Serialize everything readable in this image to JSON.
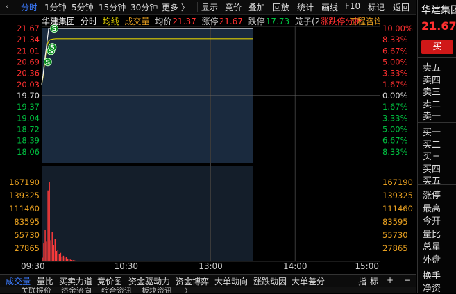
{
  "top_tabs": [
    {
      "label": "分时",
      "active": true
    },
    {
      "label": "1分钟",
      "active": false
    },
    {
      "label": "5分钟",
      "active": false
    },
    {
      "label": "15分钟",
      "active": false
    },
    {
      "label": "30分钟",
      "active": false
    },
    {
      "label": "更多 〉",
      "active": false
    }
  ],
  "top_tools": [
    "显示",
    "竞价",
    "叠加",
    "回放",
    "统计",
    "画线",
    "F10",
    "标记",
    "返回"
  ],
  "info": {
    "name": "华建集团",
    "period": "分时",
    "avg_label": "均线",
    "vol_label": "成交量",
    "avg_price_label": "均价",
    "avg_price": "21.37",
    "limit_up_label": "涨停",
    "limit_up": "21.67",
    "limit_down_label": "跌停",
    "limit_down": "17.73",
    "cage_label": "笼子(2",
    "cage_tail": "涨跌停分析",
    "overlay_text": "工程咨询"
  },
  "chart_data": {
    "type": "line",
    "price_ticks": [
      "21.67",
      "21.34",
      "21.01",
      "20.69",
      "20.36",
      "20.03",
      "19.70",
      "19.37",
      "19.04",
      "18.72",
      "18.39",
      "18.06"
    ],
    "pct_ticks": [
      "10.00%",
      "8.33%",
      "6.67%",
      "5.00%",
      "3.33%",
      "1.67%",
      "0.00%",
      "1.67%",
      "3.33%",
      "5.00%",
      "6.67%",
      "8.33%"
    ],
    "vol_ticks": [
      "167190",
      "139325",
      "111460",
      "83595",
      "55730",
      "27865"
    ],
    "time_ticks": [
      "09:30",
      "10:30",
      "13:00",
      "14:00",
      "15:00"
    ],
    "prev_close": 19.7,
    "ylim": [
      17.73,
      21.67
    ],
    "vol_max": 195055,
    "price": {
      "t": [
        0,
        1,
        2,
        3,
        4,
        5,
        6,
        8,
        10,
        15,
        30,
        60,
        90,
        120,
        150
      ],
      "v": [
        20.03,
        20.3,
        20.69,
        21.01,
        21.34,
        21.67,
        21.67,
        21.67,
        21.67,
        21.67,
        21.67,
        21.67,
        21.67,
        21.67,
        21.67
      ]
    },
    "average": {
      "t": [
        0,
        1,
        2,
        3,
        4,
        5,
        6,
        8,
        10,
        15,
        30,
        60,
        90,
        120,
        150
      ],
      "v": [
        20.03,
        20.25,
        20.62,
        20.95,
        21.2,
        21.3,
        21.34,
        21.36,
        21.37,
        21.37,
        21.37,
        21.37,
        21.37,
        21.37,
        21.37
      ]
    },
    "volume": [
      8000,
      38000,
      66000,
      42000,
      150000,
      168000,
      45000,
      62000,
      35000,
      48000,
      22000,
      25000,
      15000,
      18000,
      10000,
      12000,
      8000,
      9000,
      6000,
      5000,
      4000,
      3000,
      2500,
      2000
    ],
    "signals": [
      {
        "label": "S",
        "t": 0.4,
        "v": 20.69
      },
      {
        "label": "S",
        "t": 2.6,
        "v": 21.01
      },
      {
        "label": "S",
        "t": 3.6,
        "v": 21.12
      },
      {
        "label": "S",
        "t": 5.0,
        "v": 21.67
      }
    ]
  },
  "bottom_tabs": [
    {
      "label": "成交量",
      "active": true
    },
    {
      "label": "量比",
      "active": false
    },
    {
      "label": "买卖力道",
      "active": false
    },
    {
      "label": "竞价图",
      "active": false
    },
    {
      "label": "资金驱动力",
      "active": false
    },
    {
      "label": "资金博弈",
      "active": false
    },
    {
      "label": "大单动向",
      "active": false
    },
    {
      "label": "涨跌动因",
      "active": false
    },
    {
      "label": "大单差分",
      "active": false
    }
  ],
  "bottom_tools": [
    "指",
    "标",
    "+",
    "−"
  ],
  "bottom2_text": "关联报价    资金流向    综合资讯    板块资讯     〉",
  "right": {
    "name": "华建集团",
    "price": "21.67",
    "buy_button": "买",
    "sell_levels": [
      "卖五",
      "卖四",
      "卖三",
      "卖二",
      "卖一"
    ],
    "buy_levels": [
      "买一",
      "买二",
      "买三",
      "买四",
      "买五"
    ],
    "stats": [
      "涨停",
      "最高",
      "今开",
      "量比",
      "总量",
      "外盘"
    ],
    "stats2": [
      "换手",
      "净资"
    ]
  },
  "colors": {
    "up": "#ff3030",
    "down": "#00c040",
    "price_line": "#f0f0f0",
    "avg_line": "#e0d000",
    "vol_bar": "#ff3b3b",
    "active_tab": "#3b7bff",
    "amber": "#e8a020"
  }
}
